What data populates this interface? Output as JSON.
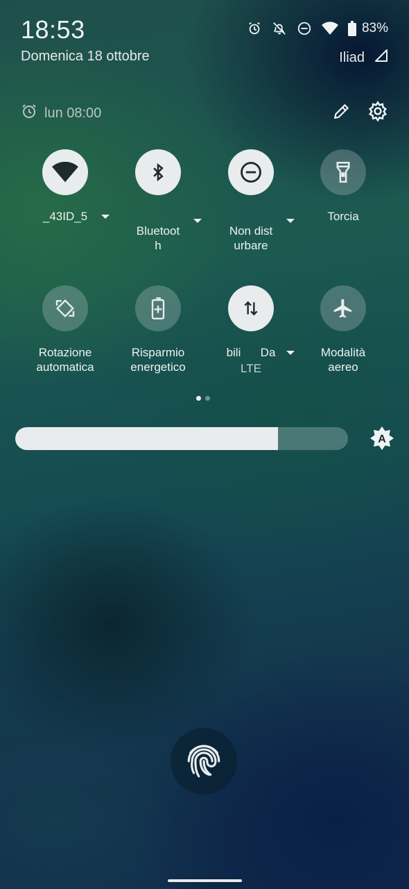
{
  "status_bar": {
    "time": "18:53",
    "date": "Domenica 18 ottobre",
    "battery_percent": "83%",
    "carrier": "Iliad",
    "icons": [
      "alarm-icon",
      "notifications-off-icon",
      "do-not-disturb-icon",
      "wifi-icon",
      "battery-icon"
    ]
  },
  "header": {
    "alarm_text": "lun 08:00",
    "alarm_icon": "alarm-icon",
    "edit_icon": "pencil-icon",
    "settings_icon": "gear-icon"
  },
  "tiles": [
    {
      "label": "_43ID_5",
      "icon": "wifi-icon",
      "active": true,
      "has_dropdown": true
    },
    {
      "label": "Bluetoot\nh",
      "icon": "bluetooth-icon",
      "active": true,
      "has_dropdown": true
    },
    {
      "label": "Non dist\nurbare",
      "icon": "do-not-disturb-icon",
      "active": true,
      "has_dropdown": true
    },
    {
      "label": "Torcia",
      "icon": "flashlight-icon",
      "active": false,
      "has_dropdown": false
    },
    {
      "label": "Rotazione\nautomatica",
      "icon": "auto-rotate-icon",
      "active": false,
      "has_dropdown": false
    },
    {
      "label": "Risparmio\nenergetico",
      "icon": "battery-saver-icon",
      "active": false,
      "has_dropdown": false
    },
    {
      "label": "bili      Da",
      "sublabel": "LTE",
      "icon": "mobile-data-icon",
      "active": true,
      "has_dropdown": true
    },
    {
      "label": "Modalità\naereo",
      "icon": "airplane-icon",
      "active": false,
      "has_dropdown": false
    }
  ],
  "pager": {
    "pages": 2,
    "current": 1
  },
  "brightness": {
    "level": 0.79,
    "auto_icon": "auto-brightness-icon",
    "auto_label": "A"
  },
  "colors": {
    "tile_on": "#e8ecec",
    "tile_off": "#5f7478",
    "text": "#eef1f1"
  }
}
